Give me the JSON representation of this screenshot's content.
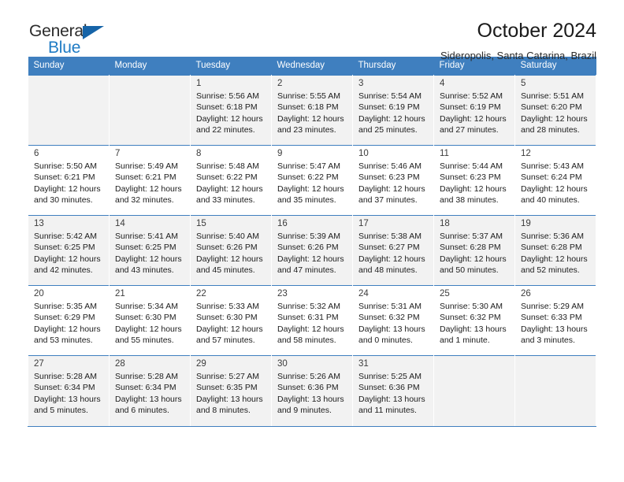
{
  "brand": {
    "word1": "General",
    "word2": "Blue",
    "logo_icon": "triangle-flag-icon",
    "accent_color": "#1f7bc4"
  },
  "header": {
    "title": "October 2024",
    "subtitle": "Sideropolis, Santa Catarina, Brazil"
  },
  "theme": {
    "header_row_color": "#3f7fbf",
    "shade_row_color": "#f2f2f2",
    "text_color": "#1c1c1c"
  },
  "weekday_headers": [
    "Sunday",
    "Monday",
    "Tuesday",
    "Wednesday",
    "Thursday",
    "Friday",
    "Saturday"
  ],
  "labels": {
    "sunrise": "Sunrise:",
    "sunset": "Sunset:",
    "daylight": "Daylight:"
  },
  "weeks": [
    [
      {
        "day": "",
        "empty": true,
        "sunrise": "",
        "sunset": "",
        "daylight1": "",
        "daylight2": ""
      },
      {
        "day": "",
        "empty": true,
        "sunrise": "",
        "sunset": "",
        "daylight1": "",
        "daylight2": ""
      },
      {
        "day": "1",
        "sunrise": "Sunrise: 5:56 AM",
        "sunset": "Sunset: 6:18 PM",
        "daylight1": "Daylight: 12 hours",
        "daylight2": "and 22 minutes."
      },
      {
        "day": "2",
        "sunrise": "Sunrise: 5:55 AM",
        "sunset": "Sunset: 6:18 PM",
        "daylight1": "Daylight: 12 hours",
        "daylight2": "and 23 minutes."
      },
      {
        "day": "3",
        "sunrise": "Sunrise: 5:54 AM",
        "sunset": "Sunset: 6:19 PM",
        "daylight1": "Daylight: 12 hours",
        "daylight2": "and 25 minutes."
      },
      {
        "day": "4",
        "sunrise": "Sunrise: 5:52 AM",
        "sunset": "Sunset: 6:19 PM",
        "daylight1": "Daylight: 12 hours",
        "daylight2": "and 27 minutes."
      },
      {
        "day": "5",
        "sunrise": "Sunrise: 5:51 AM",
        "sunset": "Sunset: 6:20 PM",
        "daylight1": "Daylight: 12 hours",
        "daylight2": "and 28 minutes."
      }
    ],
    [
      {
        "day": "6",
        "sunrise": "Sunrise: 5:50 AM",
        "sunset": "Sunset: 6:21 PM",
        "daylight1": "Daylight: 12 hours",
        "daylight2": "and 30 minutes."
      },
      {
        "day": "7",
        "sunrise": "Sunrise: 5:49 AM",
        "sunset": "Sunset: 6:21 PM",
        "daylight1": "Daylight: 12 hours",
        "daylight2": "and 32 minutes."
      },
      {
        "day": "8",
        "sunrise": "Sunrise: 5:48 AM",
        "sunset": "Sunset: 6:22 PM",
        "daylight1": "Daylight: 12 hours",
        "daylight2": "and 33 minutes."
      },
      {
        "day": "9",
        "sunrise": "Sunrise: 5:47 AM",
        "sunset": "Sunset: 6:22 PM",
        "daylight1": "Daylight: 12 hours",
        "daylight2": "and 35 minutes."
      },
      {
        "day": "10",
        "sunrise": "Sunrise: 5:46 AM",
        "sunset": "Sunset: 6:23 PM",
        "daylight1": "Daylight: 12 hours",
        "daylight2": "and 37 minutes."
      },
      {
        "day": "11",
        "sunrise": "Sunrise: 5:44 AM",
        "sunset": "Sunset: 6:23 PM",
        "daylight1": "Daylight: 12 hours",
        "daylight2": "and 38 minutes."
      },
      {
        "day": "12",
        "sunrise": "Sunrise: 5:43 AM",
        "sunset": "Sunset: 6:24 PM",
        "daylight1": "Daylight: 12 hours",
        "daylight2": "and 40 minutes."
      }
    ],
    [
      {
        "day": "13",
        "sunrise": "Sunrise: 5:42 AM",
        "sunset": "Sunset: 6:25 PM",
        "daylight1": "Daylight: 12 hours",
        "daylight2": "and 42 minutes."
      },
      {
        "day": "14",
        "sunrise": "Sunrise: 5:41 AM",
        "sunset": "Sunset: 6:25 PM",
        "daylight1": "Daylight: 12 hours",
        "daylight2": "and 43 minutes."
      },
      {
        "day": "15",
        "sunrise": "Sunrise: 5:40 AM",
        "sunset": "Sunset: 6:26 PM",
        "daylight1": "Daylight: 12 hours",
        "daylight2": "and 45 minutes."
      },
      {
        "day": "16",
        "sunrise": "Sunrise: 5:39 AM",
        "sunset": "Sunset: 6:26 PM",
        "daylight1": "Daylight: 12 hours",
        "daylight2": "and 47 minutes."
      },
      {
        "day": "17",
        "sunrise": "Sunrise: 5:38 AM",
        "sunset": "Sunset: 6:27 PM",
        "daylight1": "Daylight: 12 hours",
        "daylight2": "and 48 minutes."
      },
      {
        "day": "18",
        "sunrise": "Sunrise: 5:37 AM",
        "sunset": "Sunset: 6:28 PM",
        "daylight1": "Daylight: 12 hours",
        "daylight2": "and 50 minutes."
      },
      {
        "day": "19",
        "sunrise": "Sunrise: 5:36 AM",
        "sunset": "Sunset: 6:28 PM",
        "daylight1": "Daylight: 12 hours",
        "daylight2": "and 52 minutes."
      }
    ],
    [
      {
        "day": "20",
        "sunrise": "Sunrise: 5:35 AM",
        "sunset": "Sunset: 6:29 PM",
        "daylight1": "Daylight: 12 hours",
        "daylight2": "and 53 minutes."
      },
      {
        "day": "21",
        "sunrise": "Sunrise: 5:34 AM",
        "sunset": "Sunset: 6:30 PM",
        "daylight1": "Daylight: 12 hours",
        "daylight2": "and 55 minutes."
      },
      {
        "day": "22",
        "sunrise": "Sunrise: 5:33 AM",
        "sunset": "Sunset: 6:30 PM",
        "daylight1": "Daylight: 12 hours",
        "daylight2": "and 57 minutes."
      },
      {
        "day": "23",
        "sunrise": "Sunrise: 5:32 AM",
        "sunset": "Sunset: 6:31 PM",
        "daylight1": "Daylight: 12 hours",
        "daylight2": "and 58 minutes."
      },
      {
        "day": "24",
        "sunrise": "Sunrise: 5:31 AM",
        "sunset": "Sunset: 6:32 PM",
        "daylight1": "Daylight: 13 hours",
        "daylight2": "and 0 minutes."
      },
      {
        "day": "25",
        "sunrise": "Sunrise: 5:30 AM",
        "sunset": "Sunset: 6:32 PM",
        "daylight1": "Daylight: 13 hours",
        "daylight2": "and 1 minute."
      },
      {
        "day": "26",
        "sunrise": "Sunrise: 5:29 AM",
        "sunset": "Sunset: 6:33 PM",
        "daylight1": "Daylight: 13 hours",
        "daylight2": "and 3 minutes."
      }
    ],
    [
      {
        "day": "27",
        "sunrise": "Sunrise: 5:28 AM",
        "sunset": "Sunset: 6:34 PM",
        "daylight1": "Daylight: 13 hours",
        "daylight2": "and 5 minutes."
      },
      {
        "day": "28",
        "sunrise": "Sunrise: 5:28 AM",
        "sunset": "Sunset: 6:34 PM",
        "daylight1": "Daylight: 13 hours",
        "daylight2": "and 6 minutes."
      },
      {
        "day": "29",
        "sunrise": "Sunrise: 5:27 AM",
        "sunset": "Sunset: 6:35 PM",
        "daylight1": "Daylight: 13 hours",
        "daylight2": "and 8 minutes."
      },
      {
        "day": "30",
        "sunrise": "Sunrise: 5:26 AM",
        "sunset": "Sunset: 6:36 PM",
        "daylight1": "Daylight: 13 hours",
        "daylight2": "and 9 minutes."
      },
      {
        "day": "31",
        "sunrise": "Sunrise: 5:25 AM",
        "sunset": "Sunset: 6:36 PM",
        "daylight1": "Daylight: 13 hours",
        "daylight2": "and 11 minutes."
      },
      {
        "day": "",
        "empty": true,
        "sunrise": "",
        "sunset": "",
        "daylight1": "",
        "daylight2": ""
      },
      {
        "day": "",
        "empty": true,
        "sunrise": "",
        "sunset": "",
        "daylight1": "",
        "daylight2": ""
      }
    ]
  ]
}
